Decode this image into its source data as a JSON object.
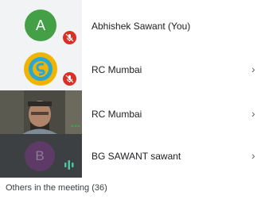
{
  "participants": [
    {
      "name": "Abhishek Sawant (You)",
      "avatar_letter": "A",
      "avatar_color": "#43a047",
      "muted": true
    },
    {
      "name": "RC Mumbai",
      "avatar_icon": "logo-icon",
      "muted": true
    },
    {
      "name": "RC Mumbai",
      "video": true
    },
    {
      "name": "BG SAWANT sawant",
      "avatar_letter": "B",
      "avatar_color": "#5e3a66",
      "speaking": true
    }
  ],
  "chevron_glyph": "›",
  "others_label": "Others in the meeting (36)",
  "colors": {
    "accent": "#1a73e8",
    "muted_badge": "#d93025",
    "speaking": "#34a853"
  }
}
